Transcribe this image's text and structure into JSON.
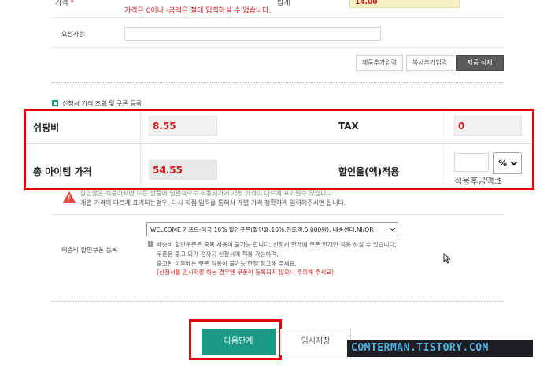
{
  "top_row": {
    "price_label": "가격",
    "price_warning": "가격은 0이나 -금액은 절대 입력하실 수 없습니다.",
    "subtotal_label": "합계",
    "subtotal_value": "14.00"
  },
  "request": {
    "label": "요청사항",
    "value": ""
  },
  "product_buttons": {
    "add_product": "제품추가입력",
    "copy_add": "복사추가입력",
    "delete_product": "제품 삭제"
  },
  "section": {
    "title": "신청서 가격 조회 및 쿠폰 등록"
  },
  "price_panel": {
    "shipping_label": "쉬핑비",
    "shipping_value": "8.55",
    "tax_label": "TAX",
    "tax_value": "0",
    "total_label": "총 아이템 가격",
    "total_value": "54.55",
    "discount_label": "할인율(액)적용",
    "discount_value": "",
    "discount_unit": "%",
    "after_discount_label": "적용후금액:$"
  },
  "notice": {
    "line1": "할인율은 적용하시면 모든 상품에 일괄적으로 적용되기에 개별 가격이 다르게 표기될수 있습니다",
    "line2": "개별 가격이 다르게 표기되는경우. 다시 직접 입력을 통해서 개별 가격 정확하게 입력해주시면 됩니다."
  },
  "coupon": {
    "label": "배송비 할인쿠폰 등록",
    "selected": "WELCOME 기프트-미국 10% 할인쿠폰(할인율:10%,한도액:5,000원), 배송센터:NJ/OR",
    "info1": "배송비 할인쿠폰은 중복 사용이 불가능 합니다. 신청서 한개에 쿠폰 한개만 적용 하실 수 있습니다.",
    "info2": "쿠폰은 출고 되기 전까지 신청서에 적용 가능하며,",
    "info3": "출고된 이후에는 쿠폰 적용이 불가능 한점 참고해 주세요.",
    "warning": "(신청서를 임시저장 하는 경우엔 쿠폰이 등록되지 않으니 주의해 주세요)"
  },
  "actions": {
    "next": "다음단계",
    "temp_save": "임시저장"
  },
  "watermark": {
    "text": "COMTERMAN.TISTORY.COM"
  },
  "colors": {
    "highlight_red": "#e8000b",
    "accent_green": "#1a9a86",
    "value_red": "#d11a1a"
  }
}
